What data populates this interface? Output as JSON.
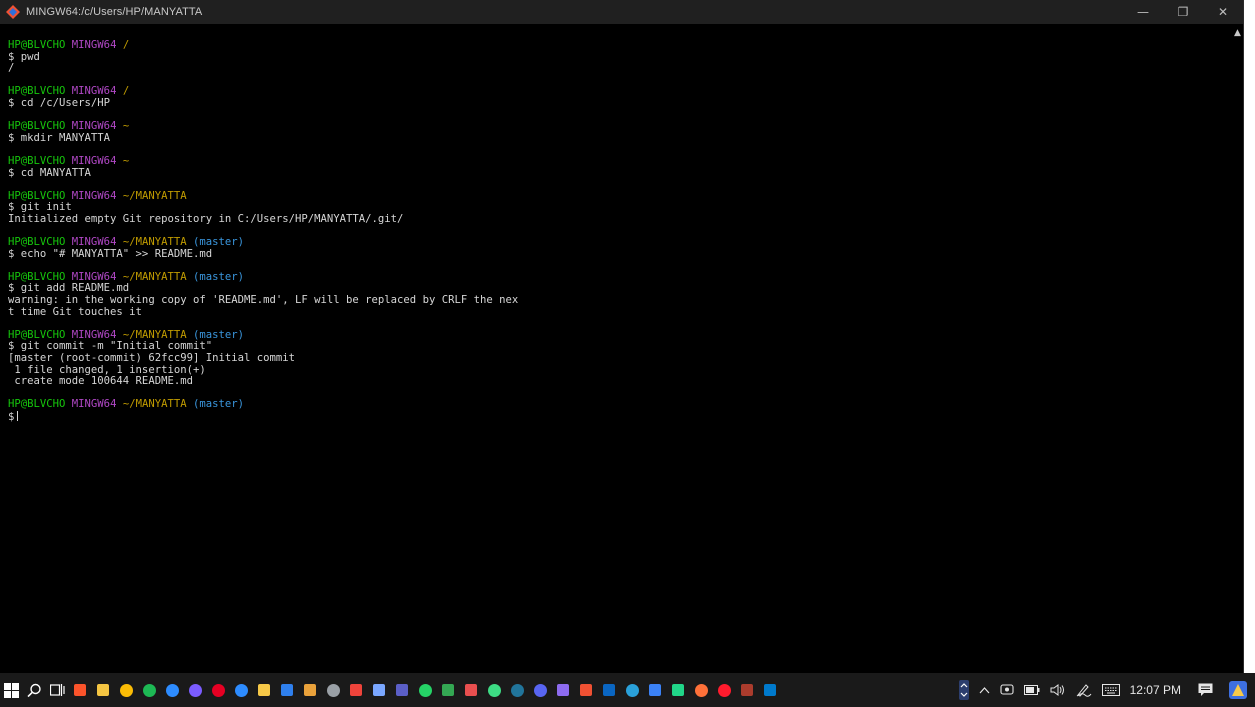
{
  "window": {
    "title": "MINGW64:/c/Users/HP/MANYATTA",
    "controls": {
      "minimize": "—",
      "maximize": "❐",
      "close": "✕"
    }
  },
  "colors": {
    "user": "#16c60c",
    "host": "#b148c6",
    "path": "#c19c00",
    "branch": "#3a96dd",
    "text": "#d6d6d6"
  },
  "terminal": {
    "blocks": [
      {
        "prompt": {
          "user": "HP@BLVCHO",
          "host": "MINGW64",
          "path": "/",
          "branch": ""
        },
        "command": "$ pwd",
        "output": [
          "/"
        ]
      },
      {
        "prompt": {
          "user": "HP@BLVCHO",
          "host": "MINGW64",
          "path": "/",
          "branch": ""
        },
        "command": "$ cd /c/Users/HP",
        "output": []
      },
      {
        "prompt": {
          "user": "HP@BLVCHO",
          "host": "MINGW64",
          "path": "~",
          "branch": ""
        },
        "command": "$ mkdir MANYATTA",
        "output": []
      },
      {
        "prompt": {
          "user": "HP@BLVCHO",
          "host": "MINGW64",
          "path": "~",
          "branch": ""
        },
        "command": "$ cd MANYATTA",
        "output": []
      },
      {
        "prompt": {
          "user": "HP@BLVCHO",
          "host": "MINGW64",
          "path": "~/MANYATTA",
          "branch": ""
        },
        "command": "$ git init",
        "output": [
          "Initialized empty Git repository in C:/Users/HP/MANYATTA/.git/"
        ]
      },
      {
        "prompt": {
          "user": "HP@BLVCHO",
          "host": "MINGW64",
          "path": "~/MANYATTA",
          "branch": "(master)"
        },
        "command": "$ echo \"# MANYATTA\" >> README.md",
        "output": []
      },
      {
        "prompt": {
          "user": "HP@BLVCHO",
          "host": "MINGW64",
          "path": "~/MANYATTA",
          "branch": "(master)"
        },
        "command": "$ git add README.md",
        "output": [
          "warning: in the working copy of 'README.md', LF will be replaced by CRLF the nex",
          "t time Git touches it"
        ]
      },
      {
        "prompt": {
          "user": "HP@BLVCHO",
          "host": "MINGW64",
          "path": "~/MANYATTA",
          "branch": "(master)"
        },
        "command": "$ git commit -m \"Initial commit\"",
        "output": [
          "[master (root-commit) 62fcc99] Initial commit",
          " 1 file changed, 1 insertion(+)",
          " create mode 100644 README.md"
        ]
      }
    ],
    "final_prompt": {
      "user": "HP@BLVCHO",
      "host": "MINGW64",
      "path": "~/MANYATTA",
      "branch": "(master)"
    },
    "input_prefix": "$"
  },
  "taskbar": {
    "apps": [
      {
        "name": "brave-icon",
        "color": "#fb542b",
        "shape": "sq"
      },
      {
        "name": "file-explorer-icon",
        "color": "#f4c542",
        "shape": "sq"
      },
      {
        "name": "chrome-icon",
        "color": "#fbbc05",
        "shape": "circ"
      },
      {
        "name": "spotify-icon",
        "color": "#1db954",
        "shape": "circ"
      },
      {
        "name": "cortana-icon",
        "color": "#2d8cff",
        "shape": "circ"
      },
      {
        "name": "github-desktop-icon",
        "color": "#7b5cff",
        "shape": "circ"
      },
      {
        "name": "pinterest-icon",
        "color": "#e60023",
        "shape": "circ"
      },
      {
        "name": "zoom-icon",
        "color": "#2d8cff",
        "shape": "circ"
      },
      {
        "name": "sticky-notes-icon",
        "color": "#f7c948",
        "shape": "sq"
      },
      {
        "name": "photos-icon",
        "color": "#2f80ed",
        "shape": "sq"
      },
      {
        "name": "paint-icon",
        "color": "#e9a23b",
        "shape": "sq"
      },
      {
        "name": "clock-icon",
        "color": "#9aa0a6",
        "shape": "circ"
      },
      {
        "name": "anydesk-icon",
        "color": "#ef443b",
        "shape": "sq"
      },
      {
        "name": "brush-icon",
        "color": "#7aa7ff",
        "shape": "sq"
      },
      {
        "name": "teams-icon",
        "color": "#5b5fc7",
        "shape": "sq"
      },
      {
        "name": "whatsapp-icon",
        "color": "#25d366",
        "shape": "circ"
      },
      {
        "name": "screen-icon",
        "color": "#34a853",
        "shape": "sq"
      },
      {
        "name": "notes-icon",
        "color": "#e94f4f",
        "shape": "sq"
      },
      {
        "name": "android-icon",
        "color": "#3ddc84",
        "shape": "circ"
      },
      {
        "name": "wordpress-icon",
        "color": "#21759b",
        "shape": "circ"
      },
      {
        "name": "discord-icon",
        "color": "#5865f2",
        "shape": "circ"
      },
      {
        "name": "chart-icon",
        "color": "#8e6cf0",
        "shape": "sq"
      },
      {
        "name": "git-icon",
        "color": "#f05133",
        "shape": "sq"
      },
      {
        "name": "linkedin-icon",
        "color": "#0a66c2",
        "shape": "sq"
      },
      {
        "name": "telegram-icon",
        "color": "#2aa1da",
        "shape": "circ"
      },
      {
        "name": "diamond-icon",
        "color": "#3b82f6",
        "shape": "sq"
      },
      {
        "name": "pycharm-icon",
        "color": "#21d789",
        "shape": "sq"
      },
      {
        "name": "firefox-icon",
        "color": "#ff7139",
        "shape": "circ"
      },
      {
        "name": "opera-icon",
        "color": "#ff1b2d",
        "shape": "circ"
      },
      {
        "name": "git-bash-icon",
        "color": "#ab3c2d",
        "shape": "sq"
      },
      {
        "name": "vscode-icon",
        "color": "#007acc",
        "shape": "sq"
      }
    ],
    "clock": "12:07 PM"
  }
}
